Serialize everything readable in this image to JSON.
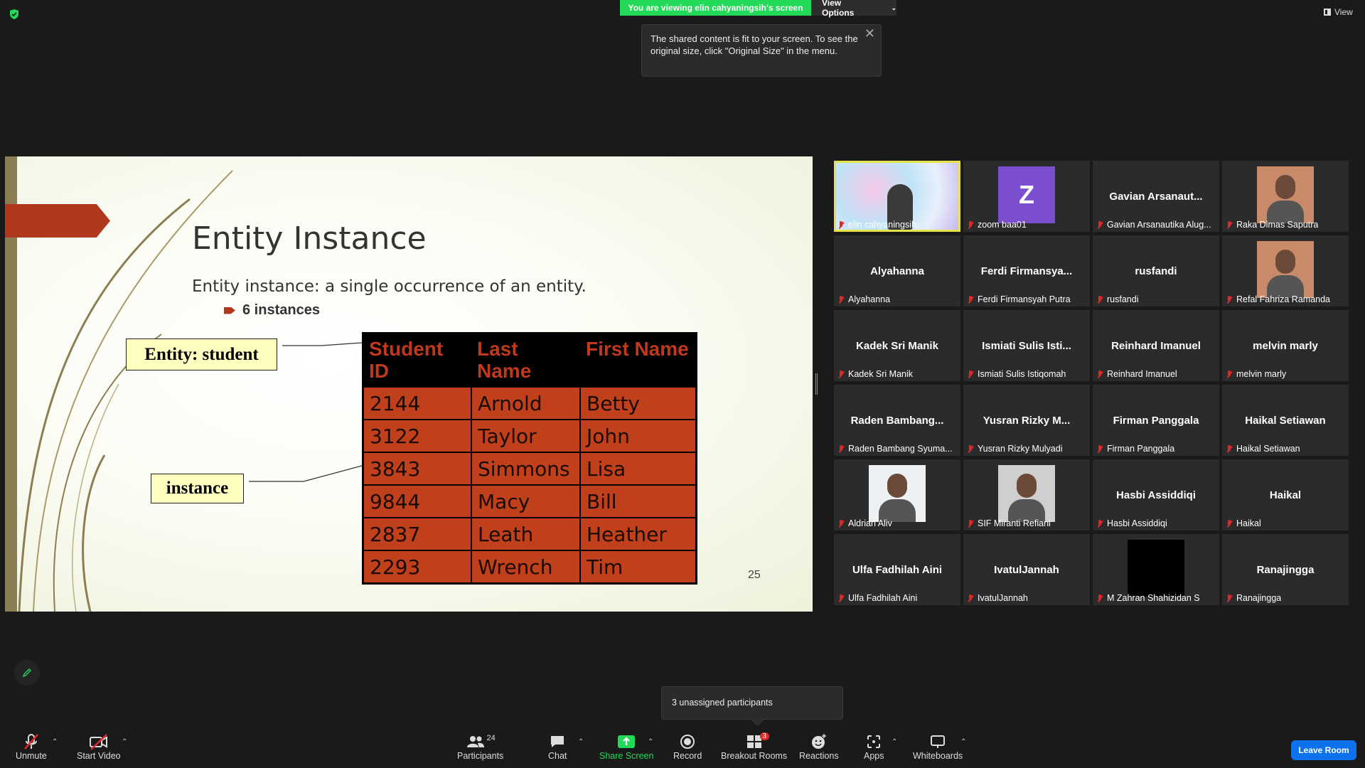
{
  "top": {
    "banner": "You are viewing elin cahyaningsih's screen",
    "view_options": "View Options",
    "view": "View",
    "tooltip": "The shared content is fit to your screen. To see the original size, click \"Original Size\" in the menu."
  },
  "slide": {
    "title": "Entity Instance",
    "subtitle": "Entity instance: a single occurrence of an entity.",
    "bullet": "6 instances",
    "label_entity": "Entity: student",
    "label_instance": "instance",
    "page_number": "25",
    "table": {
      "headers": [
        "Student ID",
        "Last Name",
        "First Name"
      ],
      "rows": [
        [
          "2144",
          "Arnold",
          "Betty"
        ],
        [
          "3122",
          "Taylor",
          "John"
        ],
        [
          "3843",
          "Simmons",
          "Lisa"
        ],
        [
          "9844",
          "Macy",
          "Bill"
        ],
        [
          "2837",
          "Leath",
          "Heather"
        ],
        [
          "2293",
          "Wrench",
          "Tim"
        ]
      ]
    }
  },
  "participants": [
    {
      "name": "",
      "label": "elin cahyaningsih",
      "avatar": "video"
    },
    {
      "name": "",
      "label": "zoom baa01",
      "avatar": "letter",
      "letter": "Z"
    },
    {
      "name": "Gavian Arsanaut...",
      "label": "Gavian Arsanautika Alug..."
    },
    {
      "name": "",
      "label": "Raka Dimas Saputra",
      "avatar": "photo"
    },
    {
      "name": "Alyahanna",
      "label": "Alyahanna"
    },
    {
      "name": "Ferdi Firmansya...",
      "label": "Ferdi Firmansyah Putra"
    },
    {
      "name": "rusfandi",
      "label": "rusfandi"
    },
    {
      "name": "",
      "label": "Refal Fahriza Ramanda",
      "avatar": "photo"
    },
    {
      "name": "Kadek Sri Manik",
      "label": "Kadek Sri Manik"
    },
    {
      "name": "Ismiati Sulis Isti...",
      "label": "Ismiati Sulis Istiqomah"
    },
    {
      "name": "Reinhard Imanuel",
      "label": "Reinhard Imanuel"
    },
    {
      "name": "melvin marly",
      "label": "melvin marly"
    },
    {
      "name": "Raden Bambang...",
      "label": "Raden Bambang Syuma..."
    },
    {
      "name": "Yusran Rizky M...",
      "label": "Yusran Rizky Mulyadi"
    },
    {
      "name": "Firman Panggala",
      "label": "Firman Panggala"
    },
    {
      "name": "Haikal Setiawan",
      "label": "Haikal Setiawan"
    },
    {
      "name": "",
      "label": "Aldrian Aliv",
      "avatar": "photo"
    },
    {
      "name": "",
      "label": "SIF Miranti Refiani",
      "avatar": "photo"
    },
    {
      "name": "Hasbi Assiddiqi",
      "label": "Hasbi Assiddiqi"
    },
    {
      "name": "Haikal",
      "label": "Haikal"
    },
    {
      "name": "Ulfa Fadhilah Aini",
      "label": "Ulfa Fadhilah Aini"
    },
    {
      "name": "IvatulJannah",
      "label": "IvatulJannah"
    },
    {
      "name": "",
      "label": "M Zahran Shahizidan S",
      "avatar": "black"
    },
    {
      "name": "Ranajingga",
      "label": "Ranajingga"
    }
  ],
  "popup": "3 unassigned participants",
  "toolbar": {
    "unmute": "Unmute",
    "start_video": "Start Video",
    "participants": "Participants",
    "participants_count": "24",
    "chat": "Chat",
    "share_screen": "Share Screen",
    "record": "Record",
    "breakout_rooms": "Breakout Rooms",
    "breakout_badge": "3",
    "reactions": "Reactions",
    "apps": "Apps",
    "whiteboards": "Whiteboards",
    "leave_room": "Leave Room"
  },
  "colors": {
    "banner_green": "#23d959",
    "leave_blue": "#0e72ed",
    "slide_accent": "#b0381c",
    "table_cell": "#c0401c",
    "active_speaker": "#e5e34a"
  }
}
